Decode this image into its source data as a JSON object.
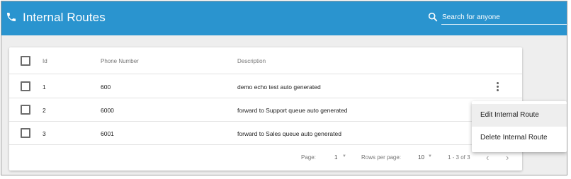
{
  "header": {
    "title": "Internal Routes",
    "search_placeholder": "Search for anyone"
  },
  "table": {
    "columns": [
      "Id",
      "Phone Number",
      "Description"
    ],
    "rows": [
      {
        "id": "1",
        "phone": "600",
        "description": "demo echo test auto generated"
      },
      {
        "id": "2",
        "phone": "6000",
        "description": "forward to Support queue auto generated"
      },
      {
        "id": "3",
        "phone": "6001",
        "description": "forward to Sales queue auto generated"
      }
    ]
  },
  "pagination": {
    "page_label": "Page:",
    "page_value": "1",
    "rows_label": "Rows per page:",
    "rows_value": "10",
    "range": "1 - 3 of 3"
  },
  "context_menu": {
    "items": [
      "Edit Internal Route",
      "Delete Internal Route"
    ]
  },
  "icons": {
    "phone": "phone-icon",
    "search": "search-icon",
    "more": "more-vert-icon",
    "prev": "chevron-left-icon",
    "next": "chevron-right-icon"
  },
  "colors": {
    "header": "#2a94cf",
    "background": "#eeeeee"
  }
}
